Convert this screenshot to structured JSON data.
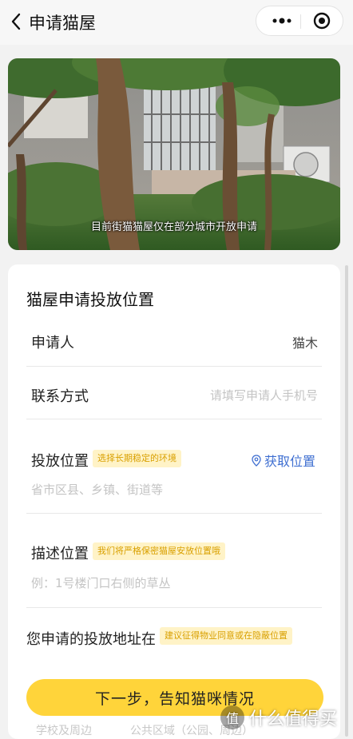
{
  "nav": {
    "title": "申请猫屋",
    "back_icon": "chevron-left-icon",
    "more_icon": "more-dots-icon",
    "close_icon": "target-circle-icon"
  },
  "banner": {
    "caption": "目前街猫猫屋仅在部分城市开放申请"
  },
  "form": {
    "title": "猫屋申请投放位置",
    "applicant": {
      "label": "申请人",
      "value": "猫木"
    },
    "contact": {
      "label": "联系方式",
      "placeholder": "请填写申请人手机号"
    },
    "location": {
      "label": "投放位置",
      "tag": "选择长期稳定的环境",
      "action": "获取位置",
      "action_icon": "location-pin-icon",
      "placeholder": "省市区县、乡镇、街道等"
    },
    "describe": {
      "label": "描述位置",
      "tag": "我们将严格保密猫屋安放位置哦",
      "placeholder": "例：1号楼门口右侧的草丛"
    },
    "address": {
      "label": "您申请的投放地址在",
      "tag": "建议征得物业同意或在隐蔽位置"
    },
    "next_button": "下一步，告知猫咪情况",
    "options_partial": [
      "学校及周边",
      "公共区域（公园、周边）"
    ]
  },
  "watermark": {
    "circle": "值",
    "text": "什么值得买"
  },
  "colors": {
    "accent_yellow": "#ffd43a",
    "tag_bg": "#fff3c7",
    "tag_text": "#d9a000",
    "link_blue": "#3f6fd1"
  }
}
